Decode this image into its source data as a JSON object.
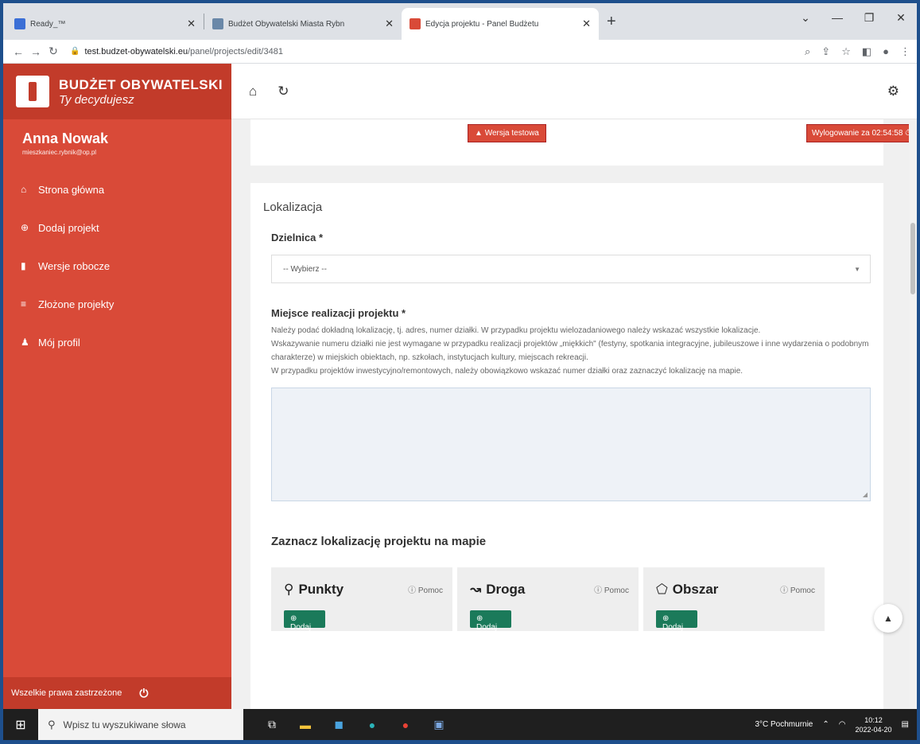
{
  "browser": {
    "tabs": [
      {
        "title": "Ready_™",
        "active": false,
        "favicon_color": "#3b6fd6"
      },
      {
        "title": "Budżet Obywatelski Miasta Rybn",
        "active": false,
        "favicon_color": "#6a88a8"
      },
      {
        "title": "Edycja projektu - Panel Budżetu",
        "active": true,
        "favicon_color": "#d94a38"
      }
    ],
    "url_host": "test.budzet-obywatelski.eu",
    "url_path": "/panel/projects/edit/3481"
  },
  "brand": {
    "line1": "BUDŻET OBYWATELSKI",
    "line2": "Ty decydujesz"
  },
  "user": {
    "name": "Anna Nowak",
    "email": "mieszkaniec.rybnik@op.pl"
  },
  "menu": [
    {
      "label": "Strona główna",
      "icon": "home-icon"
    },
    {
      "label": "Dodaj projekt",
      "icon": "plus-circle-icon"
    },
    {
      "label": "Wersje robocze",
      "icon": "file-icon"
    },
    {
      "label": "Złożone projekty",
      "icon": "list-icon"
    },
    {
      "label": "Mój profil",
      "icon": "user-icon"
    }
  ],
  "footer": {
    "text": "Wszelkie prawa zastrzeżone"
  },
  "badges": {
    "test": "Wersja testowa",
    "logout": "Wylogowanie za 02:54:58"
  },
  "form": {
    "section_title": "Lokalizacja",
    "district_label": "Dzielnica *",
    "district_value": "-- Wybierz --",
    "place_label": "Miejsce realizacji projektu *",
    "help_lines": [
      "Należy podać dokładną lokalizację, tj. adres, numer działki. W przypadku projektu wielozadaniowego należy wskazać wszystkie lokalizacje.",
      "Wskazywanie numeru działki nie jest wymagane w przypadku realizacji projektów „miękkich\" (festyny, spotkania integracyjne, jubileuszowe i inne wydarzenia o podobnym charakterze) w miejskich obiektach, np. szkołach, instytucjach kultury, miejscach rekreacji.",
      "W przypadku projektów inwestycyjno/remontowych, należy obowiązkowo wskazać numer działki oraz zaznaczyć lokalizację na mapie."
    ],
    "place_value": "",
    "map_title": "Zaznacz lokalizację projektu na mapie"
  },
  "map_tools": [
    {
      "name": "Punkty",
      "icon": "map-marker-icon",
      "help": "Pomoc",
      "add": "Dodaj"
    },
    {
      "name": "Droga",
      "icon": "route-icon",
      "help": "Pomoc",
      "add": "Dodaj"
    },
    {
      "name": "Obszar",
      "icon": "polygon-icon",
      "help": "Pomoc",
      "add": "Dodaj"
    }
  ],
  "taskbar": {
    "search_placeholder": "Wpisz tu wyszukiwane słowa",
    "weather": "3°C Pochmurnie",
    "time": "10:12",
    "date": "2022-04-20"
  }
}
